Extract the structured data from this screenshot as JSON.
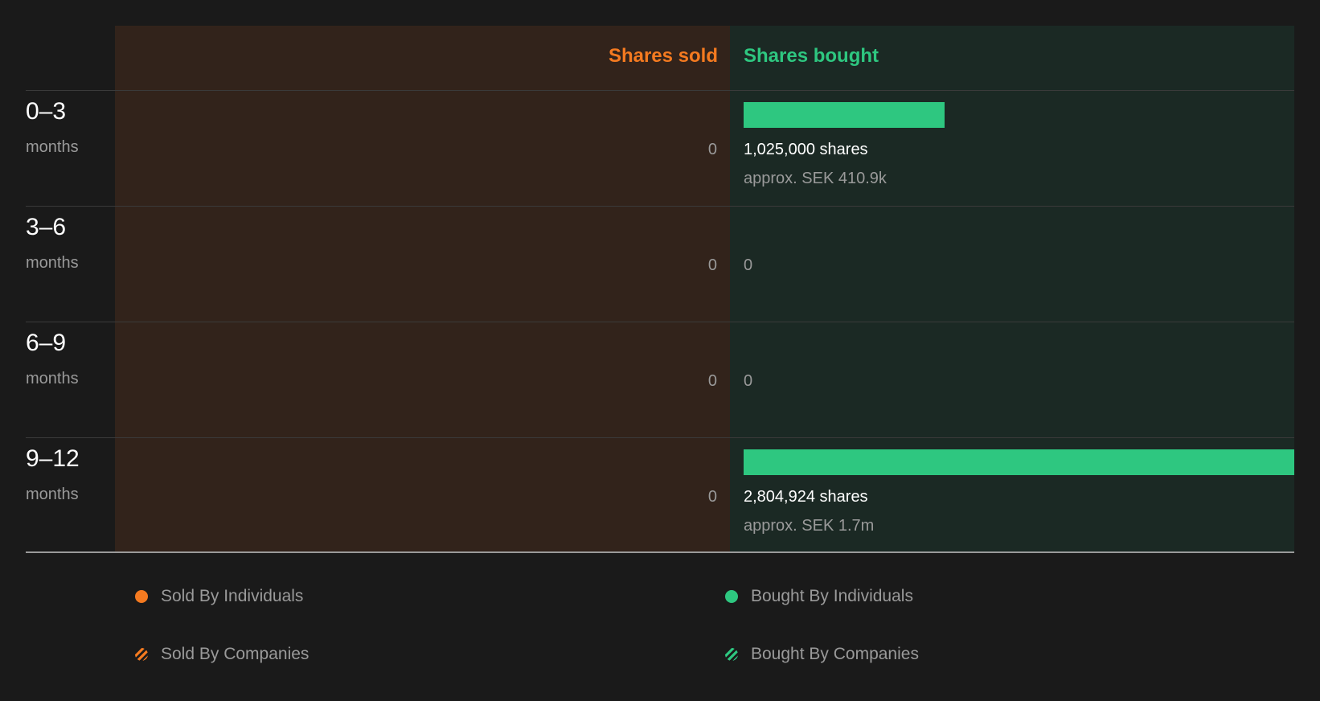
{
  "chart_data": {
    "type": "bar",
    "headers": {
      "sold": "Shares sold",
      "bought": "Shares bought"
    },
    "rows": [
      {
        "range": "0–3",
        "unit": "months",
        "sold": 0,
        "sold_label": "0",
        "bought": 1025000,
        "bought_label": "1,025,000 shares",
        "approx": "approx. SEK 410.9k"
      },
      {
        "range": "3–6",
        "unit": "months",
        "sold": 0,
        "sold_label": "0",
        "bought": 0,
        "bought_label": "0",
        "approx": ""
      },
      {
        "range": "6–9",
        "unit": "months",
        "sold": 0,
        "sold_label": "0",
        "bought": 0,
        "bought_label": "0",
        "approx": ""
      },
      {
        "range": "9–12",
        "unit": "months",
        "sold": 0,
        "sold_label": "0",
        "bought": 2804924,
        "bought_label": "2,804,924 shares",
        "approx": "approx. SEK 1.7m"
      }
    ],
    "bought_max": 2804924,
    "legend": [
      {
        "label": "Sold By Individuals",
        "style": "solid",
        "color": "#f47a20"
      },
      {
        "label": "Bought By Individuals",
        "style": "solid",
        "color": "#2ec780"
      },
      {
        "label": "Sold By Companies",
        "style": "striped",
        "color": "#f47a20"
      },
      {
        "label": "Bought By Companies",
        "style": "striped",
        "color": "#2ec780"
      }
    ],
    "colors": {
      "sold": "#f47a20",
      "bought": "#2ec780"
    }
  }
}
